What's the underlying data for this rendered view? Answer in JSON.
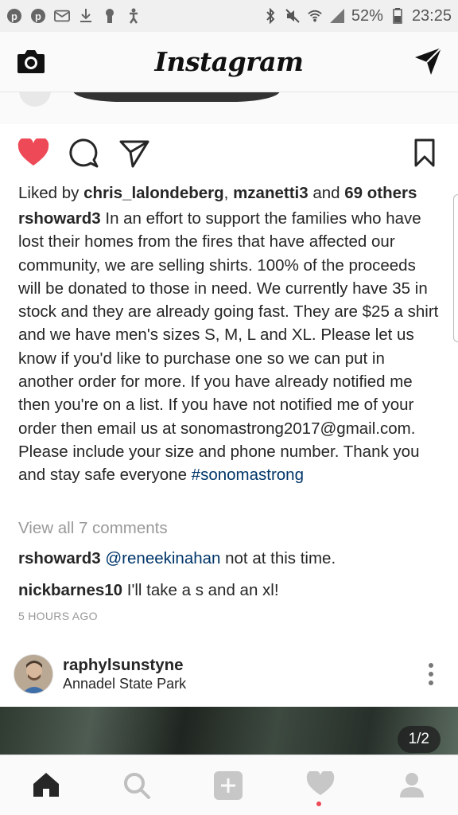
{
  "status_bar": {
    "battery": "52%",
    "time": "23:25"
  },
  "header": {
    "logo": "Instagram"
  },
  "post": {
    "likes": {
      "prefix": "Liked by ",
      "user1": "chris_lalondeberg",
      "sep": ", ",
      "user2": "mzanetti3",
      "and": " and ",
      "others": "69 others"
    },
    "caption": {
      "username": "rshoward3",
      "text": " In an effort to support the families who have lost their homes from the fires that have affected our community, we are selling shirts. 100% of the proceeds will be donated to those in need. We currently have 35 in stock and they are already going fast. They are $25 a shirt and we have men's sizes S, M, L and XL. Please let us know if you'd like to purchase one so we can put in another order for more. If you have already notified me then you're on a list. If you have not notified me of your order then email us at sonomastrong2017@gmail.com. Please include your size and phone number. Thank you and stay safe everyone ",
      "hashtag": "#sonomastrong"
    },
    "view_all": "View all 7 comments",
    "comments": [
      {
        "username": "rshoward3",
        "mention": "@reneekinahan",
        "text": " not at this time."
      },
      {
        "username": "nickbarnes10",
        "text": " I'll take a s and an xl!"
      }
    ],
    "time": "5 HOURS AGO"
  },
  "next_post": {
    "username": "raphylsunstyne",
    "location": "Annadel State Park",
    "counter": "1/2"
  },
  "colors": {
    "like_red": "#ed4956",
    "link_blue": "#003569"
  }
}
